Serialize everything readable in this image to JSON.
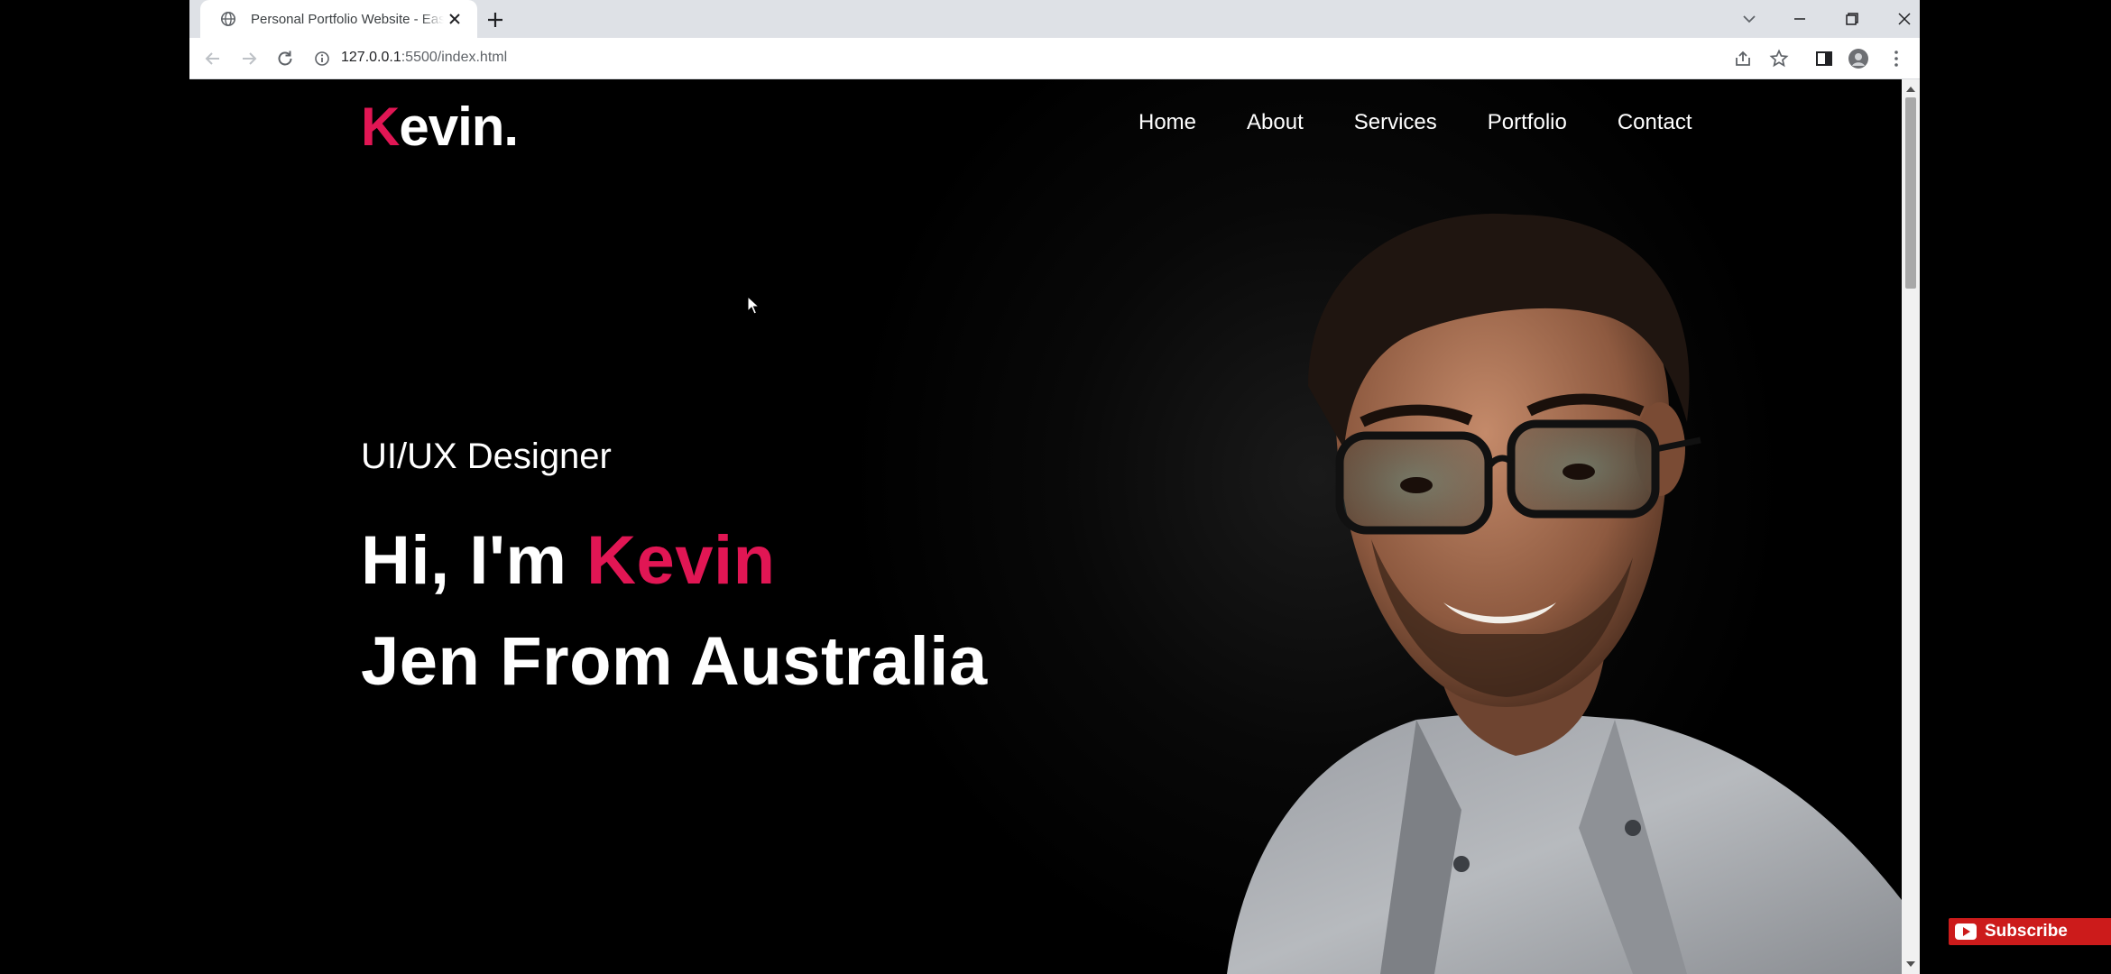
{
  "browser": {
    "tab_title": "Personal Portfolio Website - Easy",
    "url_host": "127.0.0.1",
    "url_path": ":5500/index.html"
  },
  "site": {
    "logo_initial": "K",
    "logo_rest": "evin.",
    "nav": [
      "Home",
      "About",
      "Services",
      "Portfolio",
      "Contact"
    ],
    "subtitle": "UI/UX Designer",
    "headline_prefix": "Hi, I'm ",
    "headline_name": "Kevin",
    "headline_line2": "Jen From Australia",
    "accent_color": "#e11654"
  },
  "overlay": {
    "subscribe_label": "Subscribe"
  },
  "icons": {
    "tab_favicon": "globe-icon",
    "tab_close": "close-icon",
    "new_tab": "plus-icon",
    "back": "arrow-left-icon",
    "forward": "arrow-right-icon",
    "reload": "reload-icon",
    "site_info": "info-icon",
    "share": "share-icon",
    "bookmark": "star-icon",
    "side_panel": "side-panel-icon",
    "profile": "avatar",
    "menu": "kebab-menu-icon"
  }
}
